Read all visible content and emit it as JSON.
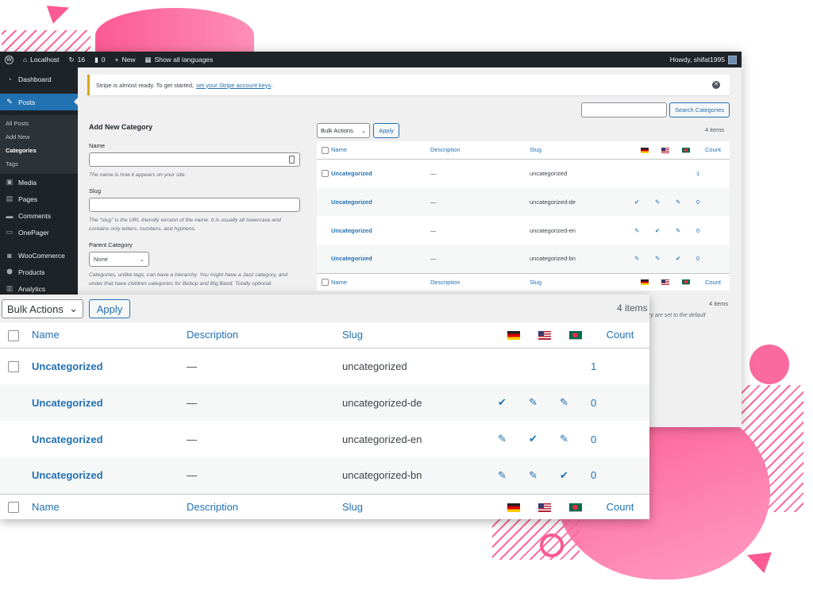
{
  "admin_bar": {
    "site_name": "Localhost",
    "updates_count": "16",
    "comments_count": "0",
    "new_label": "New",
    "languages_label": "Show all languages",
    "greeting": "Howdy, shifat1995"
  },
  "sidebar": {
    "items": [
      {
        "label": "Dashboard",
        "icon": "dashboard-icon"
      },
      {
        "label": "Posts",
        "icon": "pin-icon"
      },
      {
        "label": "Media",
        "icon": "media-icon"
      },
      {
        "label": "Pages",
        "icon": "pages-icon"
      },
      {
        "label": "Comments",
        "icon": "comments-icon"
      },
      {
        "label": "OnePager",
        "icon": "onepager-icon"
      },
      {
        "label": "WooCommerce",
        "icon": "woocommerce-icon"
      },
      {
        "label": "Products",
        "icon": "products-icon"
      },
      {
        "label": "Analytics",
        "icon": "analytics-icon"
      }
    ],
    "posts_sub": [
      "All Posts",
      "Add New",
      "Categories",
      "Tags"
    ]
  },
  "notice": {
    "text": "Stripe is almost ready. To get started,",
    "link": "set your Stripe account keys",
    "end": "."
  },
  "search": {
    "button": "Search Categories"
  },
  "form": {
    "heading": "Add New Category",
    "name_label": "Name",
    "name_help": "The name is how it appears on your site.",
    "slug_label": "Slug",
    "slug_help": "The “slug” is the URL-friendly version of the name. It is usually all lowercase and contains only letters, numbers, and hyphens.",
    "parent_label": "Parent Category",
    "parent_value": "None",
    "parent_help": "Categories, unlike tags, can have a hierarchy. You might have a Jazz category, and under that have children categories for Bebop and Big Band. Totally optional."
  },
  "list": {
    "bulk_label": "Bulk Actions",
    "apply_label": "Apply",
    "items_count": "4 items",
    "columns": {
      "name": "Name",
      "description": "Description",
      "slug": "Slug",
      "count": "Count"
    },
    "rows": [
      {
        "name": "Uncategorized",
        "description": "—",
        "slug": "uncategorized",
        "de": "",
        "en": "",
        "bn": "",
        "count": "1"
      },
      {
        "name": "Uncategorized",
        "description": "—",
        "slug": "uncategorized-de",
        "de": "✔",
        "en": "✎",
        "bn": "✎",
        "count": "0"
      },
      {
        "name": "Uncategorized",
        "description": "—",
        "slug": "uncategorized-en",
        "de": "✎",
        "en": "✔",
        "bn": "✎",
        "count": "0"
      },
      {
        "name": "Uncategorized",
        "description": "—",
        "slug": "uncategorized-bn",
        "de": "✎",
        "en": "✎",
        "bn": "✔",
        "count": "0"
      }
    ]
  },
  "bottom_note": "ry are set to the default",
  "colors": {
    "accent": "#2271b1",
    "adminbar": "#1d2327",
    "decor_pink": "#fb5a92",
    "notice_warning": "#dba617"
  }
}
